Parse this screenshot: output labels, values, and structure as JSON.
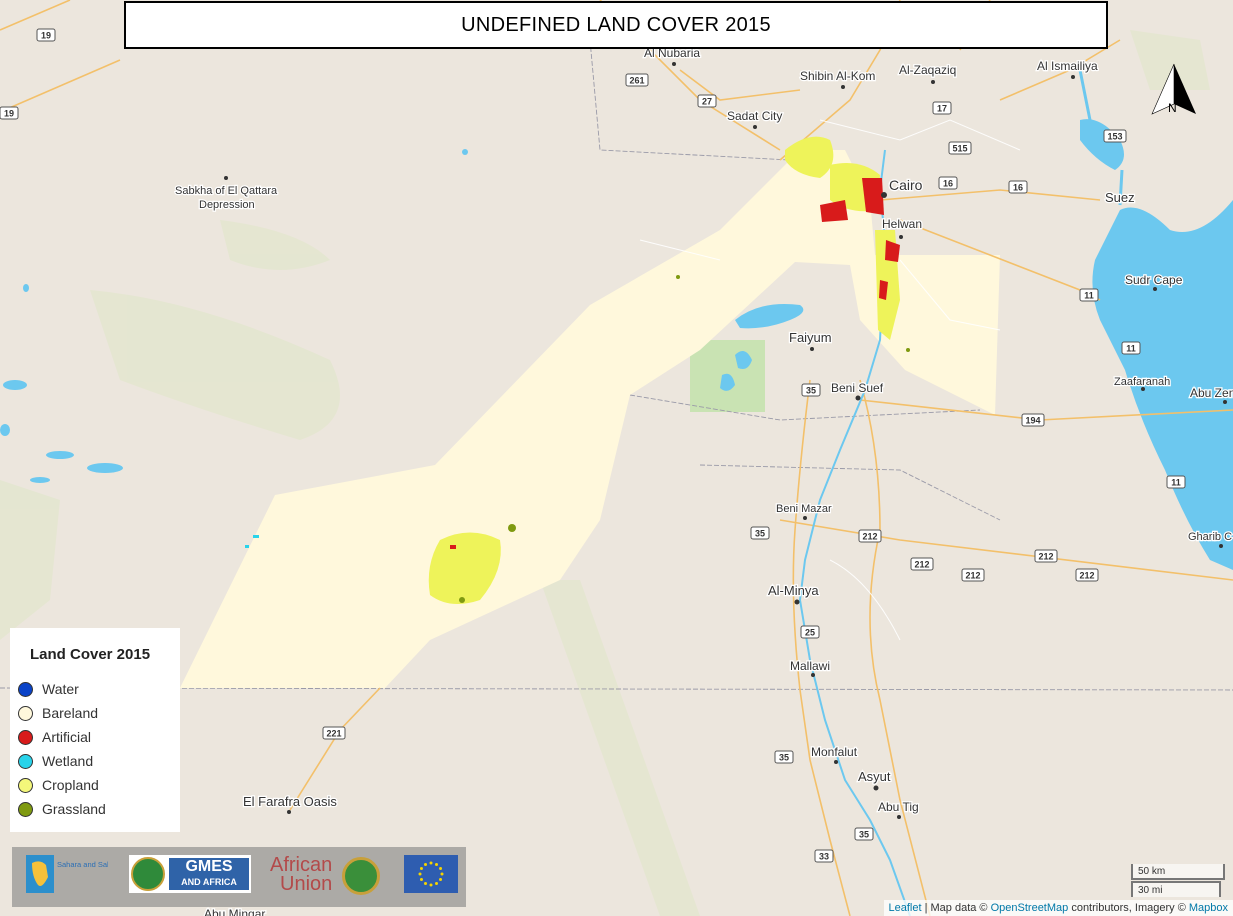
{
  "title": "UNDEFINED LAND COVER 2015",
  "legend": {
    "title": "Land Cover 2015",
    "items": [
      {
        "label": "Water",
        "color": "#0a43c8"
      },
      {
        "label": "Bareland",
        "color": "#fff8dc"
      },
      {
        "label": "Artificial",
        "color": "#d81b1b"
      },
      {
        "label": "Wetland",
        "color": "#29d3ea"
      },
      {
        "label": "Cropland",
        "color": "#f4f77a"
      },
      {
        "label": "Grassland",
        "color": "#7f9a10"
      }
    ]
  },
  "places": {
    "al_nubaria": "Al Nubaria",
    "shibin": "Shibin Al-Kom",
    "zaqaziq": "Al-Zaqaziq",
    "ismailiya": "Al Ismailiya",
    "sadat": "Sadat City",
    "qattara": "Sabkha of El Qattara",
    "qattara2": "Depression",
    "cairo": "Cairo",
    "helwan": "Helwan",
    "suez": "Suez",
    "sudr": "Sudr Cape",
    "faiyum": "Faiyum",
    "beni_suef": "Beni Suef",
    "zaafaranah": "Zaafaranah",
    "abu_zen": "Abu Zen",
    "beni_mazar": "Beni Mazar",
    "minya": "Al-Minya",
    "mallawi": "Mallawi",
    "monfalut": "Monfalut",
    "asyut": "Asyut",
    "abu_tig": "Abu Tig",
    "farafra": "El Farafra Oasis",
    "gharib": "Gharib C",
    "abu_minqar": "Abu Minqar"
  },
  "road_shields": [
    "19",
    "19",
    "261",
    "27",
    "17",
    "515",
    "16",
    "16",
    "153",
    "11",
    "11",
    "35",
    "194",
    "11",
    "35",
    "212",
    "212",
    "212",
    "212",
    "212",
    "25",
    "35",
    "221",
    "35",
    "33"
  ],
  "north_label": "N",
  "logos": {
    "oss": "Sahara and Sahel Observatory",
    "gmes_top": "GMES",
    "gmes_bottom": "AND AFRICA",
    "au_top": "African",
    "au_bottom": "Union"
  },
  "scale": {
    "km": "50 km",
    "mi": "30 mi"
  },
  "attribution": {
    "leaflet": "Leaflet",
    "sep": " | Map data © ",
    "osm": "OpenStreetMap",
    "mid": " contributors, Imagery © ",
    "mapbox": "Mapbox"
  },
  "colors": {
    "land": "#ece6dd",
    "water": "#6cc8ef",
    "road_major": "#f6c56b",
    "road_minor": "#ffffff",
    "bareland_area": "#fff8dc",
    "cropland": "#eef35a",
    "artificial": "#d81b1b",
    "protected_green": "#c9e3b3"
  }
}
